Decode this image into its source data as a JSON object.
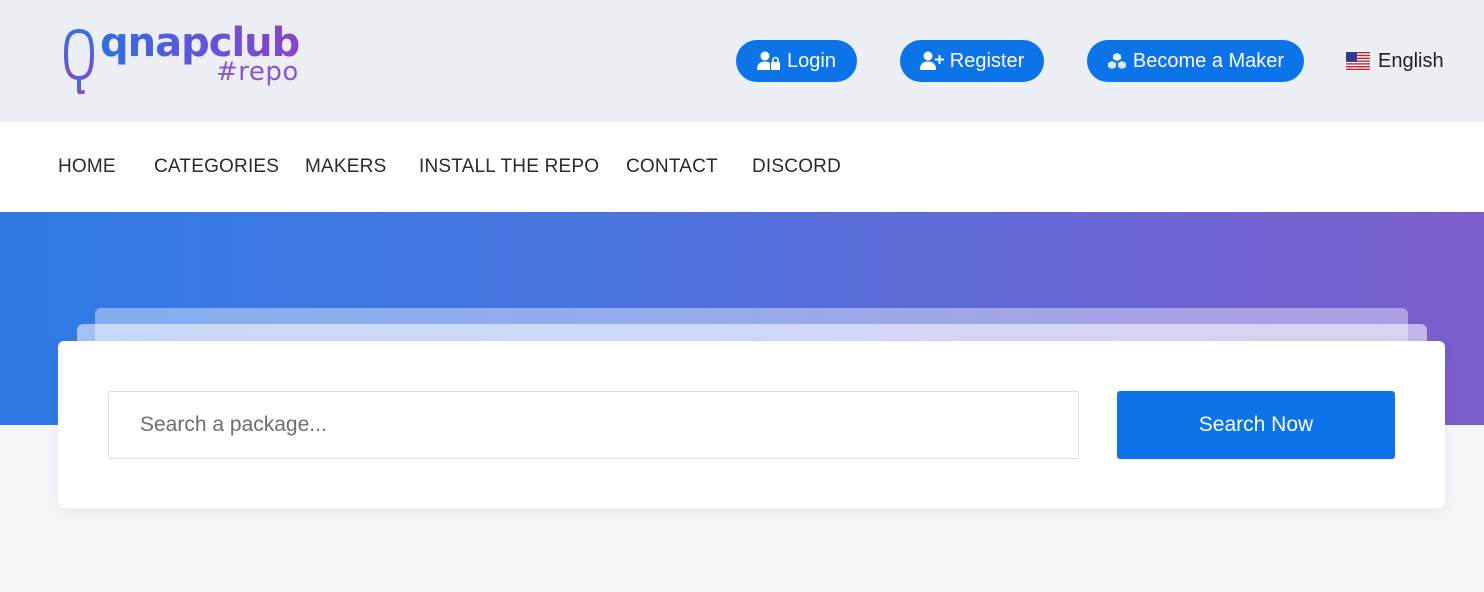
{
  "logo": {
    "main": "qnapclub",
    "sub": "#repo"
  },
  "header": {
    "login_label": "Login",
    "register_label": "Register",
    "maker_label": "Become a Maker",
    "language": "English"
  },
  "nav": {
    "items": [
      {
        "label": "HOME"
      },
      {
        "label": "CATEGORIES"
      },
      {
        "label": "MAKERS"
      },
      {
        "label": "INSTALL THE REPO"
      },
      {
        "label": "CONTACT"
      },
      {
        "label": "DISCORD"
      }
    ]
  },
  "search": {
    "placeholder": "Search a package...",
    "value": "",
    "button_label": "Search Now"
  },
  "colors": {
    "accent": "#0c74e8",
    "hero_start": "#2f7ae5",
    "hero_end": "#7b5dcc",
    "logo_purple": "#8a55cf"
  },
  "icons": {
    "login": "user-lock-icon",
    "register": "user-plus-icon",
    "maker": "cubes-icon",
    "language": "us-flag-icon"
  }
}
